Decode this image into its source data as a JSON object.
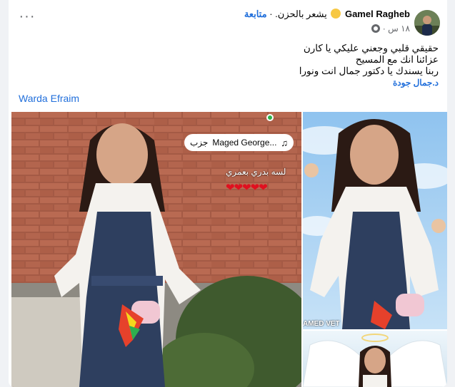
{
  "post": {
    "author": "Gamel Ragheb",
    "feeling": "يشعر بالحزن.",
    "follow_label": "متابعة",
    "separator": "·",
    "time": "١٨ س",
    "text_lines": [
      "حقيقي قلبي وجعني عليكي يا كارن",
      "عزائنا انك مع المسيح",
      "ربنا يسندك يا دكتور جمال انت ونورا"
    ],
    "tagged": "د.جمال جودة",
    "mention": "Warda Efraim"
  },
  "photo_overlay": {
    "music_label": "Maged George...",
    "music_suffix": "جزب",
    "caption": "لسه بدري بعمري",
    "hearts": "❤❤❤❤❤"
  },
  "watermark": "AMED VET",
  "icons": [
    "more-options-icon",
    "globe-icon",
    "sad-face-icon",
    "music-note-icon"
  ],
  "colors": {
    "link": "#216fdb",
    "secondary_text": "#65676b",
    "heart": "#e0101f"
  }
}
